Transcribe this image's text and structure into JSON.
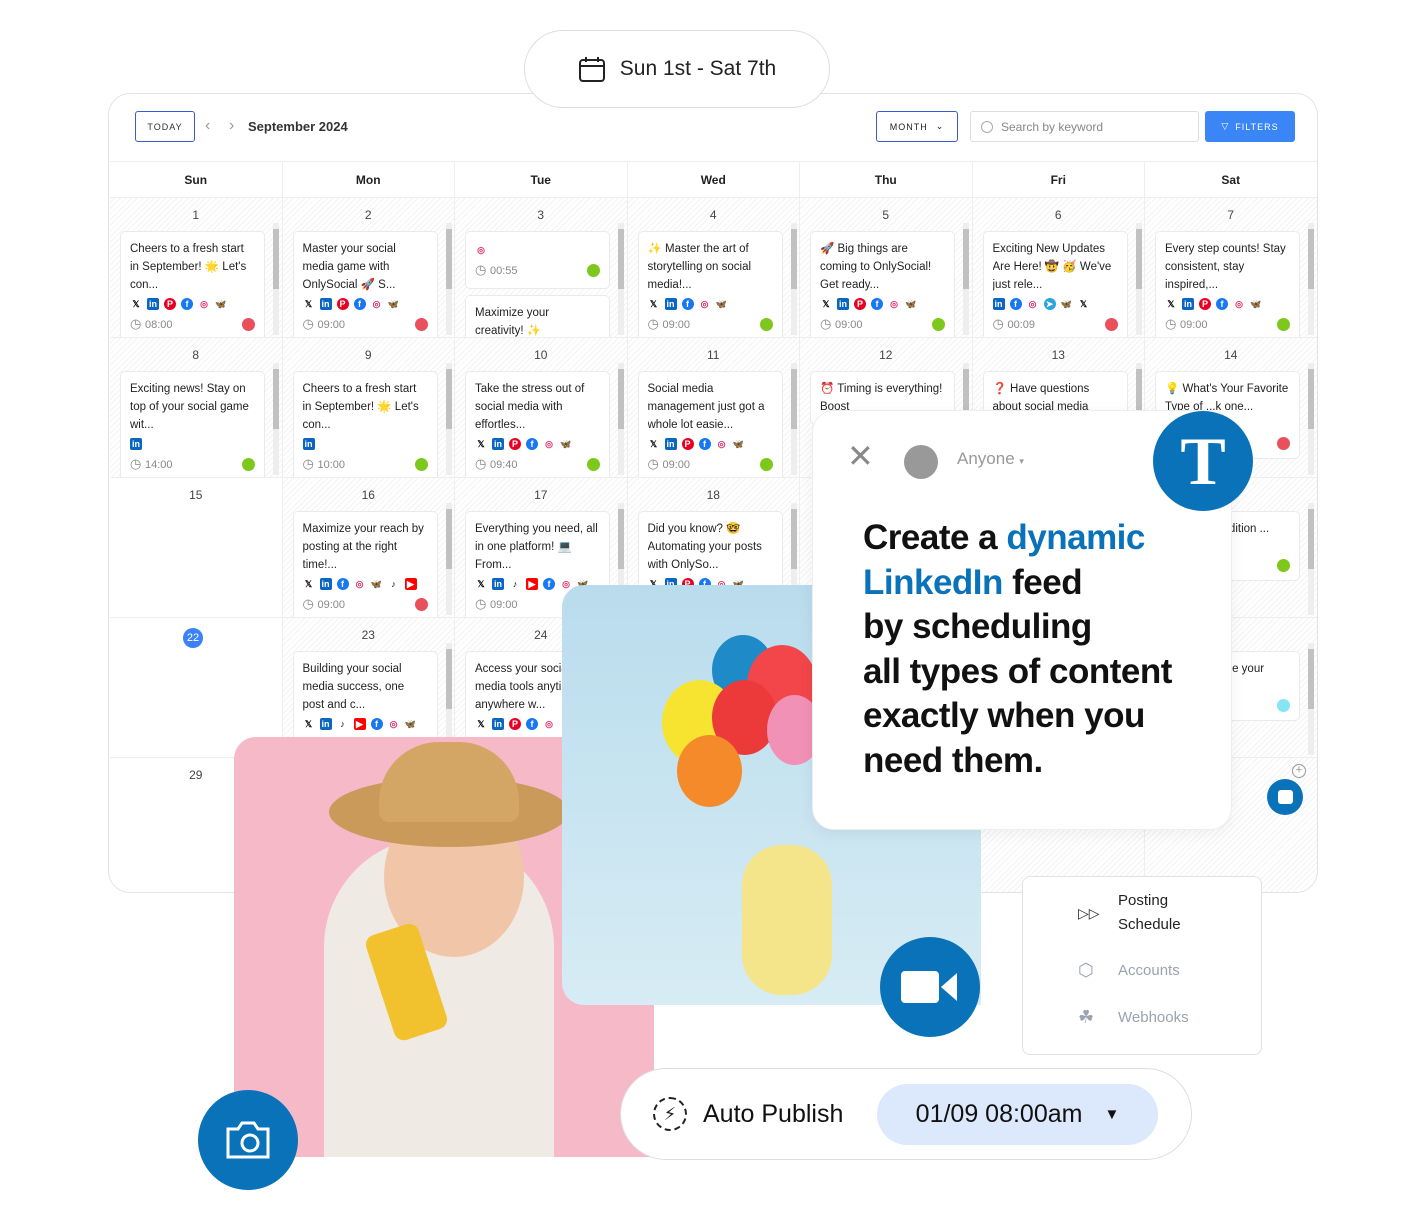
{
  "date_range_pill": {
    "label": "Sun 1st - Sat 7th",
    "icon": "calendar-icon"
  },
  "calendar": {
    "today_label": "TODAY",
    "month_title": "September 2024",
    "view_label": "MONTH",
    "search_placeholder": "Search by keyword",
    "filters_label": "FILTERS",
    "weekdays": [
      "Sun",
      "Mon",
      "Tue",
      "Wed",
      "Thu",
      "Fri",
      "Sat"
    ],
    "status_colors": {
      "red": "#e8505b",
      "green": "#7ec81e",
      "cyan": "#86e5f4"
    },
    "weeks": [
      [
        {
          "day": "1",
          "cards": [
            {
              "text": "Cheers to a fresh start in September! 🌟 Let's con...",
              "icons": [
                "x",
                "linkedin",
                "pinterest",
                "facebook",
                "instagram",
                "bluesky"
              ],
              "time": "08:00",
              "status": "red"
            }
          ]
        },
        {
          "day": "2",
          "cards": [
            {
              "text": "Master your social media game with OnlySocial 🚀 S...",
              "icons": [
                "x",
                "linkedin",
                "pinterest",
                "facebook",
                "instagram",
                "bluesky"
              ],
              "time": "09:00",
              "status": "red"
            }
          ]
        },
        {
          "day": "3",
          "cards": [
            {
              "text": "",
              "icons": [
                "instagram"
              ],
              "time": "00:55",
              "status": "green"
            },
            {
              "text": "Maximize your creativity! ✨",
              "icons": [],
              "time": "",
              "status": ""
            }
          ]
        },
        {
          "day": "4",
          "cards": [
            {
              "text": "✨ Master the art of storytelling on social media!...",
              "icons": [
                "x",
                "linkedin",
                "facebook",
                "instagram",
                "bluesky"
              ],
              "time": "09:00",
              "status": "green"
            }
          ]
        },
        {
          "day": "5",
          "cards": [
            {
              "text": "🚀 Big things are coming to OnlySocial! Get ready...",
              "icons": [
                "x",
                "linkedin",
                "pinterest",
                "facebook",
                "instagram",
                "bluesky"
              ],
              "time": "09:00",
              "status": "green"
            }
          ]
        },
        {
          "day": "6",
          "cards": [
            {
              "text": "Exciting New Updates Are Here! 🤠 🥳 We've just rele...",
              "icons": [
                "linkedin",
                "facebook",
                "instagram",
                "telegram",
                "bluesky",
                "x"
              ],
              "time": "00:09",
              "status": "red"
            }
          ]
        },
        {
          "day": "7",
          "cards": [
            {
              "text": "Every step counts! Stay consistent, stay inspired,...",
              "icons": [
                "x",
                "linkedin",
                "pinterest",
                "facebook",
                "instagram",
                "bluesky"
              ],
              "time": "09:00",
              "status": "green"
            }
          ]
        }
      ],
      [
        {
          "day": "8",
          "cards": [
            {
              "text": "Exciting news! Stay on top of your social game wit...",
              "icons": [
                "linkedin"
              ],
              "time": "14:00",
              "status": "green"
            }
          ]
        },
        {
          "day": "9",
          "cards": [
            {
              "text": "Cheers to a fresh start in September! 🌟 Let's con...",
              "icons": [
                "linkedin"
              ],
              "time": "10:00",
              "status": "green"
            }
          ]
        },
        {
          "day": "10",
          "cards": [
            {
              "text": "Take the stress out of social media with effortles...",
              "icons": [
                "x",
                "linkedin",
                "pinterest",
                "facebook",
                "instagram",
                "bluesky"
              ],
              "time": "09:40",
              "status": "green"
            }
          ]
        },
        {
          "day": "11",
          "cards": [
            {
              "text": "Social media management just got a whole lot easie...",
              "icons": [
                "x",
                "linkedin",
                "pinterest",
                "facebook",
                "instagram",
                "bluesky"
              ],
              "time": "09:00",
              "status": "green"
            }
          ]
        },
        {
          "day": "12",
          "cards": [
            {
              "text": "⏰ Timing is everything! Boost",
              "icons": [],
              "time": "",
              "status": ""
            }
          ]
        },
        {
          "day": "13",
          "cards": [
            {
              "text": "❓ Have questions about social media",
              "icons": [],
              "time": "",
              "status": ""
            }
          ]
        },
        {
          "day": "14",
          "cards": [
            {
              "text": "💡 What's Your Favorite Type of ...k one...",
              "icons": [
                "bluesky"
              ],
              "time": "",
              "status": "red"
            }
          ]
        }
      ],
      [
        {
          "day": "15",
          "cards": []
        },
        {
          "day": "16",
          "cards": [
            {
              "text": "Maximize your reach by posting at the right time!...",
              "icons": [
                "x",
                "linkedin",
                "facebook",
                "instagram",
                "bluesky",
                "tiktok",
                "youtube"
              ],
              "time": "09:00",
              "status": "red"
            }
          ]
        },
        {
          "day": "17",
          "cards": [
            {
              "text": "Everything you need, all in one platform! 💻 From...",
              "icons": [
                "x",
                "linkedin",
                "tiktok",
                "youtube",
                "facebook",
                "instagram",
                "bluesky"
              ],
              "time": "09:00",
              "status": ""
            }
          ]
        },
        {
          "day": "18",
          "cards": [
            {
              "text": "Did you know? 🤓 Automating your posts with OnlySo...",
              "icons": [
                "x",
                "linkedin",
                "pinterest",
                "facebook",
                "instagram",
                "bluesky"
              ],
              "time": "",
              "status": ""
            }
          ]
        },
        {
          "day": "",
          "cards": []
        },
        {
          "day": "",
          "cards": []
        },
        {
          "day": "",
          "cards": [
            {
              "text": "...d to ...e addition ...",
              "icons": [
                "instagram",
                "bluesky",
                "telegram"
              ],
              "time": "",
              "status": "green"
            }
          ]
        }
      ],
      [
        {
          "day": "22",
          "today": true,
          "cards": []
        },
        {
          "day": "23",
          "cards": [
            {
              "text": "Building your social media success, one post and c...",
              "icons": [
                "x",
                "linkedin",
                "tiktok",
                "youtube",
                "facebook",
                "instagram",
                "bluesky"
              ],
              "time": "",
              "status": ""
            }
          ]
        },
        {
          "day": "24",
          "cards": [
            {
              "text": "Access your social media tools anytime, anywhere w...",
              "icons": [
                "x",
                "linkedin",
                "pinterest",
                "facebook",
                "instagram"
              ],
              "time": "",
              "status": ""
            }
          ]
        },
        {
          "day": "",
          "cards": []
        },
        {
          "day": "",
          "cards": []
        },
        {
          "day": "",
          "cards": []
        },
        {
          "day": "",
          "cards": [
            {
              "text": "...sions ...mize your",
              "icons": [
                "facebook",
                "instagram",
                "bluesky"
              ],
              "time": "",
              "status": "cyan"
            }
          ]
        }
      ],
      [
        {
          "day": "29",
          "cards": []
        },
        {
          "day": "",
          "cards": []
        },
        {
          "day": "",
          "cards": []
        },
        {
          "day": "",
          "cards": []
        },
        {
          "day": "",
          "cards": []
        },
        {
          "day": "",
          "cards": []
        },
        {
          "day": "",
          "cards": []
        }
      ]
    ]
  },
  "promo_card": {
    "audience": "Anyone",
    "logo_letter": "T",
    "line1_a": "Create a ",
    "line1_b": "dynamic",
    "line2_a": "LinkedIn",
    "line2_b": " feed",
    "line3": "by scheduling",
    "line4": "all types of content",
    "line5": "exactly when you",
    "line6": "need them.",
    "accent": "#0a72b8"
  },
  "menu": {
    "items": [
      {
        "label": "Posting Schedule",
        "icon": "fast-forward-icon"
      },
      {
        "label": "Accounts",
        "icon": "cube-icon"
      },
      {
        "label": "Webhooks",
        "icon": "webhook-icon"
      }
    ]
  },
  "auto_publish": {
    "label": "Auto Publish",
    "datetime": "01/09 08:00am"
  }
}
